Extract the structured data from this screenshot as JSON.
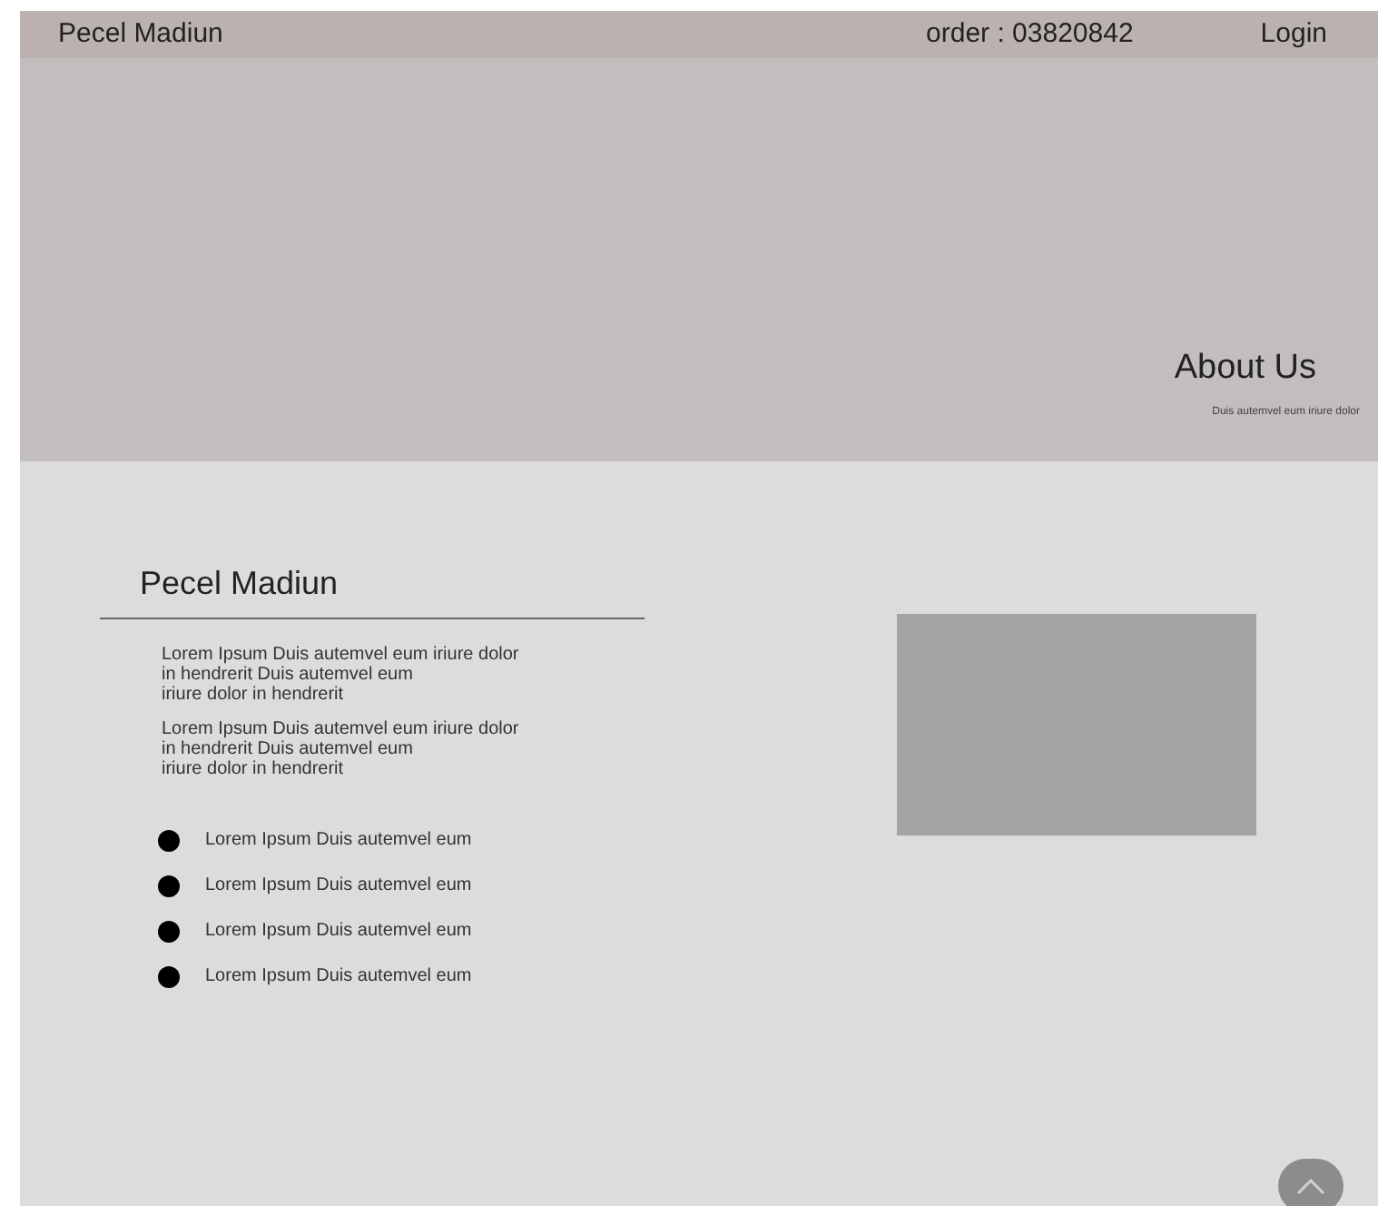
{
  "header": {
    "brand": "Pecel Madiun",
    "order": "order : 03820842",
    "login": "Login"
  },
  "hero": {
    "title": "About Us",
    "subtitle": "Duis autemvel eum iriure dolor"
  },
  "content": {
    "title": "Pecel Madiun",
    "paragraphs": [
      [
        "Lorem Ipsum Duis autemvel eum iriure dolor",
        "in hendrerit Duis autemvel eum",
        "iriure dolor in hendrerit"
      ],
      [
        "Lorem Ipsum Duis autemvel eum iriure dolor",
        "in hendrerit Duis autemvel eum",
        "iriure dolor in hendrerit"
      ]
    ],
    "bullets": [
      "Lorem Ipsum Duis autemvel eum",
      "Lorem Ipsum Duis autemvel eum",
      "Lorem Ipsum Duis autemvel eum",
      "Lorem Ipsum Duis autemvel eum"
    ]
  }
}
